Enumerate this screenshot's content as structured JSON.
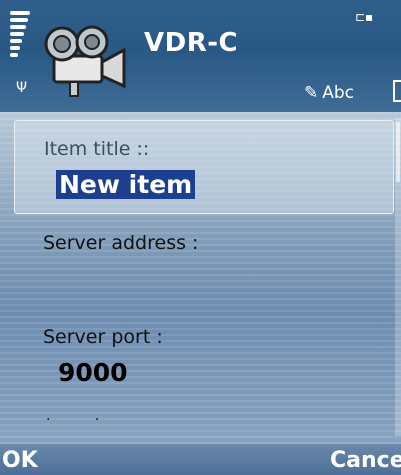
{
  "status": {
    "signal_icon": "signal-strength-icon",
    "antenna_icon": "antenna-icon",
    "battery_icon": "battery-icon"
  },
  "app": {
    "title": "VDR-C",
    "icon": "film-camera-icon"
  },
  "input_mode": {
    "icon": "pen-input-icon",
    "label": "Abc"
  },
  "form": {
    "item_title_label": "Item title ::",
    "item_title_value": "New item",
    "server_address_label": "Server address :",
    "server_address_value": "",
    "server_port_label": "Server port :",
    "server_port_value": "9000",
    "next_field_hint": ". ."
  },
  "softkeys": {
    "left": "OK",
    "right": "Cance"
  },
  "colors": {
    "title_bg": "#2f5f8a",
    "selection": "#1c3f8f",
    "softkey_bg": "#4d6f97"
  }
}
